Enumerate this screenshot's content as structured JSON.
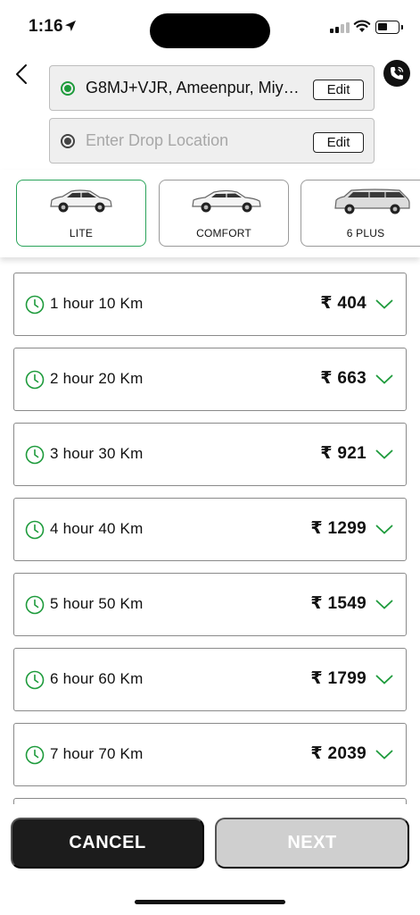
{
  "status": {
    "time": "1:16"
  },
  "locations": {
    "pickup": {
      "text": "G8MJ+VJR, Ameenpur, Miya...",
      "edit_label": "Edit"
    },
    "drop": {
      "placeholder": "Enter Drop Location",
      "edit_label": "Edit"
    }
  },
  "vehicles": [
    {
      "name": "LITE",
      "selected": true
    },
    {
      "name": "COMFORT",
      "selected": false
    },
    {
      "name": "6 PLUS",
      "selected": false
    }
  ],
  "packages": [
    {
      "label": "1 hour 10 Km",
      "price": "₹ 404"
    },
    {
      "label": "2 hour 20 Km",
      "price": "₹ 663"
    },
    {
      "label": "3 hour 30 Km",
      "price": "₹ 921"
    },
    {
      "label": "4 hour 40 Km",
      "price": "₹ 1299"
    },
    {
      "label": "5 hour 50 Km",
      "price": "₹ 1549"
    },
    {
      "label": "6 hour 60 Km",
      "price": "₹ 1799"
    },
    {
      "label": "7 hour 70 Km",
      "price": "₹ 2039"
    }
  ],
  "actions": {
    "cancel_label": "CANCEL",
    "next_label": "NEXT"
  },
  "colors": {
    "accent": "#1e9b3c",
    "selected_border": "#2aa35a",
    "disabled": "#cfcfcf",
    "dark": "#1c1c1c"
  },
  "icons": [
    "location-arrow-icon",
    "back-chevron-icon",
    "phone-call-icon",
    "radio-dot-icon",
    "car-icon",
    "clock-icon",
    "chevron-down-icon"
  ]
}
